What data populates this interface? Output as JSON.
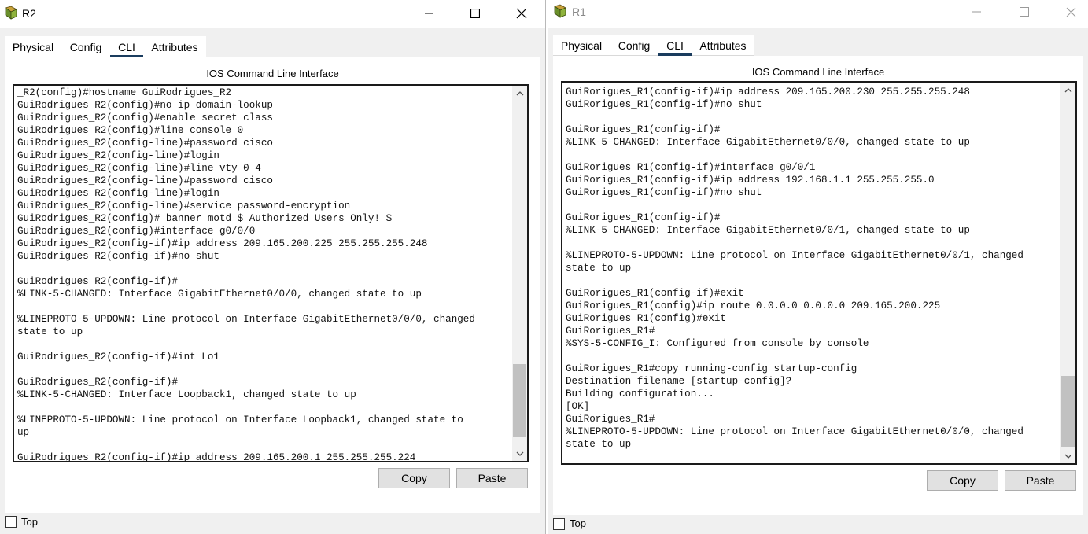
{
  "windows": [
    {
      "title": "R2",
      "tabs": [
        "Physical",
        "Config",
        "CLI",
        "Attributes"
      ],
      "active_tab": "CLI",
      "cli_heading": "IOS Command Line Interface",
      "terminal_lines": [
        "_R2(config)#hostname GuiRodrigues_R2",
        "GuiRodrigues_R2(config)#no ip domain-lookup",
        "GuiRodrigues_R2(config)#enable secret class",
        "GuiRodrigues_R2(config)#line console 0",
        "GuiRodrigues_R2(config-line)#password cisco",
        "GuiRodrigues_R2(config-line)#login",
        "GuiRodrigues_R2(config-line)#line vty 0 4",
        "GuiRodrigues_R2(config-line)#password cisco",
        "GuiRodrigues_R2(config-line)#login",
        "GuiRodrigues_R2(config-line)#service password-encryption",
        "GuiRodrigues_R2(config)# banner motd $ Authorized Users Only! $",
        "GuiRodrigues_R2(config)#interface g0/0/0",
        "GuiRodrigues_R2(config-if)#ip address 209.165.200.225 255.255.255.248",
        "GuiRodrigues_R2(config-if)#no shut",
        "",
        "GuiRodrigues_R2(config-if)#",
        "%LINK-5-CHANGED: Interface GigabitEthernet0/0/0, changed state to up",
        "",
        "%LINEPROTO-5-UPDOWN: Line protocol on Interface GigabitEthernet0/0/0, changed",
        "state to up",
        "",
        "GuiRodrigues_R2(config-if)#int Lo1",
        "",
        "GuiRodrigues_R2(config-if)#",
        "%LINK-5-CHANGED: Interface Loopback1, changed state to up",
        "",
        "%LINEPROTO-5-UPDOWN: Line protocol on Interface Loopback1, changed state to",
        "up",
        "",
        "GuiRodrigues_R2(config-if)#ip address 209.165.200.1 255.255.255.224"
      ],
      "copy_label": "Copy",
      "paste_label": "Paste",
      "top_label": "Top"
    },
    {
      "title": "R1",
      "tabs": [
        "Physical",
        "Config",
        "CLI",
        "Attributes"
      ],
      "active_tab": "CLI",
      "cli_heading": "IOS Command Line Interface",
      "terminal_lines": [
        "GuiRorigues_R1(config-if)#ip address 209.165.200.230 255.255.255.248",
        "GuiRorigues_R1(config-if)#no shut",
        "",
        "GuiRorigues_R1(config-if)#",
        "%LINK-5-CHANGED: Interface GigabitEthernet0/0/0, changed state to up",
        "",
        "GuiRorigues_R1(config-if)#interface g0/0/1",
        "GuiRorigues_R1(config-if)#ip address 192.168.1.1 255.255.255.0",
        "GuiRorigues_R1(config-if)#no shut",
        "",
        "GuiRorigues_R1(config-if)#",
        "%LINK-5-CHANGED: Interface GigabitEthernet0/0/1, changed state to up",
        "",
        "%LINEPROTO-5-UPDOWN: Line protocol on Interface GigabitEthernet0/0/1, changed",
        "state to up",
        "",
        "GuiRorigues_R1(config-if)#exit",
        "GuiRorigues_R1(config)#ip route 0.0.0.0 0.0.0.0 209.165.200.225",
        "GuiRorigues_R1(config)#exit",
        "GuiRorigues_R1#",
        "%SYS-5-CONFIG_I: Configured from console by console",
        "",
        "GuiRorigues_R1#copy running-config startup-config",
        "Destination filename [startup-config]?",
        "Building configuration...",
        "[OK]",
        "GuiRorigues_R1#",
        "%LINEPROTO-5-UPDOWN: Line protocol on Interface GigabitEthernet0/0/0, changed",
        "state to up"
      ],
      "copy_label": "Copy",
      "paste_label": "Paste",
      "top_label": "Top"
    }
  ]
}
